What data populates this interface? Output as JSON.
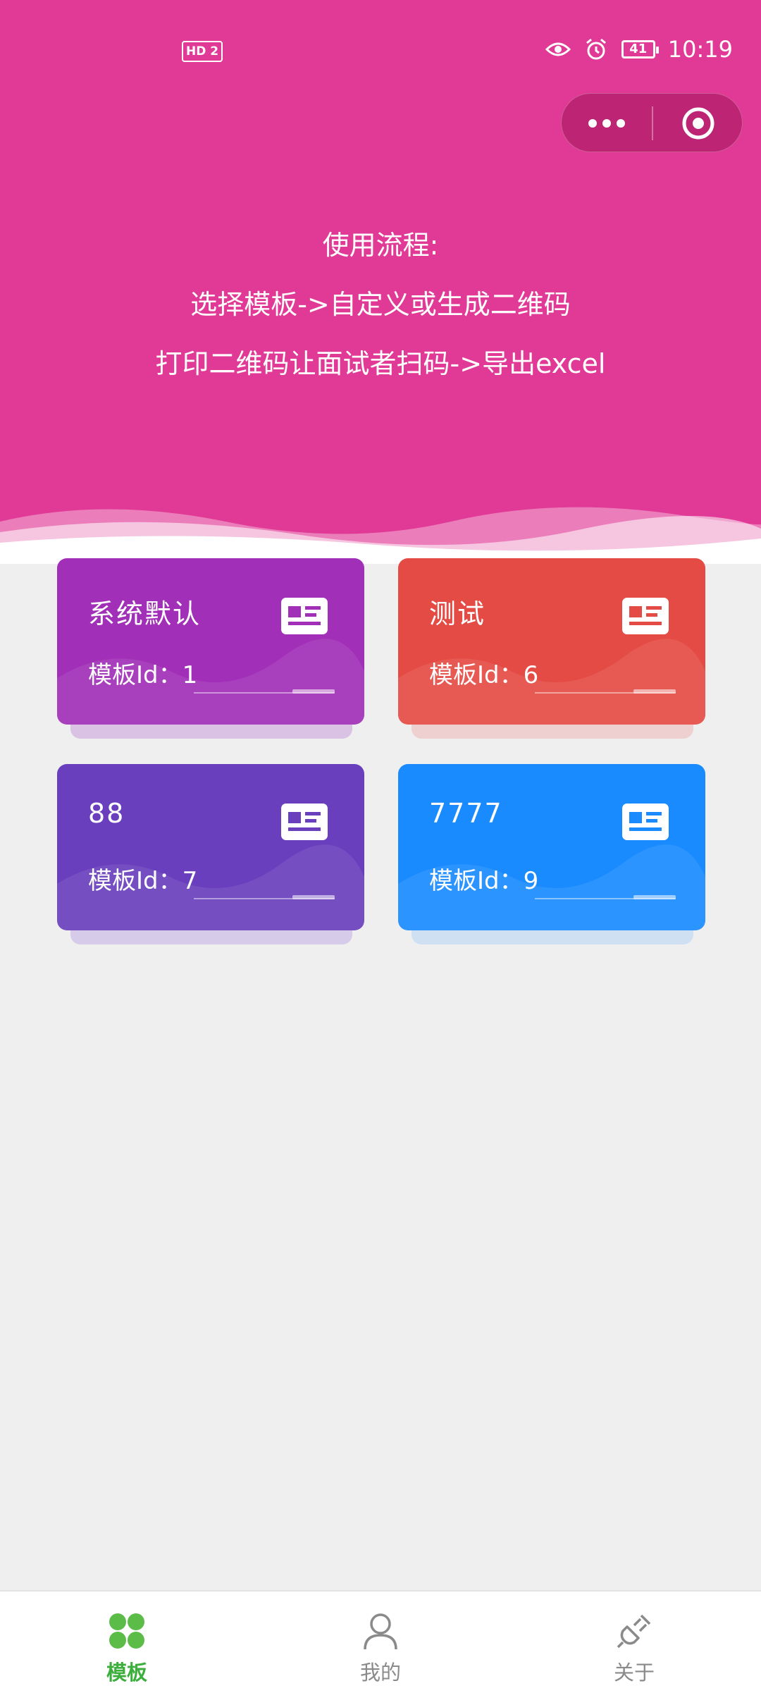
{
  "status_bar": {
    "hd_badge": "HD 2",
    "battery": "41",
    "time": "10:19"
  },
  "intro": {
    "line1": "使用流程:",
    "line2": "选择模板->自定义或生成二维码",
    "line3": "打印二维码让面试者扫码->导出excel"
  },
  "colors": {
    "header": "#e13a96",
    "card_purple": "#a12fb7",
    "card_red": "#e54b45",
    "card_violet": "#6a3fbd",
    "card_blue": "#1a8bff",
    "tab_active": "#3cae3c"
  },
  "templates": [
    {
      "name": "系统默认",
      "id_label": "模板Id：1",
      "color": "#a12fb7",
      "icon": "id-card-icon"
    },
    {
      "name": "测试",
      "id_label": "模板Id：6",
      "color": "#e54b45",
      "icon": "id-card-icon"
    },
    {
      "name": "88",
      "id_label": "模板Id：7",
      "color": "#6a3fbd",
      "icon": "id-card-icon"
    },
    {
      "name": "7777",
      "id_label": "模板Id：9",
      "color": "#1a8bff",
      "icon": "id-card-icon"
    }
  ],
  "tabbar": {
    "items": [
      {
        "label": "模板",
        "icon": "template-grid-icon",
        "active": true
      },
      {
        "label": "我的",
        "icon": "user-icon",
        "active": false
      },
      {
        "label": "关于",
        "icon": "plug-icon",
        "active": false
      }
    ]
  }
}
